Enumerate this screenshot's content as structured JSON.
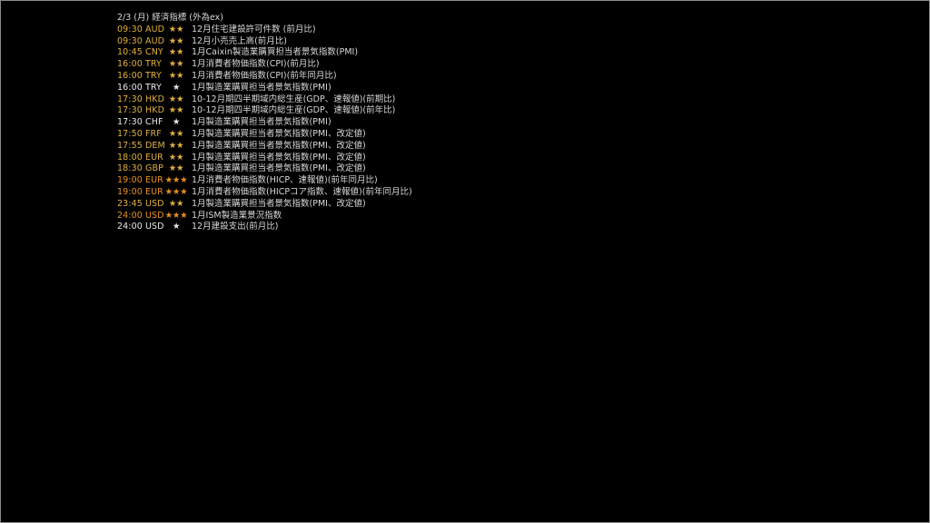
{
  "header": {
    "title": "2/3 (月) 経済指標 (外為ex)"
  },
  "colors": {
    "background": "#000000",
    "border": "#8a8a8a",
    "text_normal": "#d8d8d8",
    "importance_1": "#e8e8e8",
    "importance_2": "#e0b040",
    "importance_3": "#e89020"
  },
  "events": [
    {
      "time_currency": "09:30 AUD",
      "stars": "★★",
      "importance": 2,
      "event": "12月住宅建設許可件数 (前月比)"
    },
    {
      "time_currency": "09:30 AUD",
      "stars": "★★",
      "importance": 2,
      "event": "12月小売売上高(前月比)"
    },
    {
      "time_currency": "10:45 CNY",
      "stars": "★★",
      "importance": 2,
      "event": "1月Caixin製造業購買担当者景気指数(PMI)"
    },
    {
      "time_currency": "16:00 TRY",
      "stars": "★★",
      "importance": 2,
      "event": "1月消費者物価指数(CPI)(前月比)"
    },
    {
      "time_currency": "16:00 TRY",
      "stars": "★★",
      "importance": 2,
      "event": "1月消費者物価指数(CPI)(前年同月比)"
    },
    {
      "time_currency": "16:00 TRY",
      "stars": "★",
      "importance": 1,
      "event": "1月製造業購買担当者景気指数(PMI)"
    },
    {
      "time_currency": "17:30 HKD",
      "stars": "★★",
      "importance": 2,
      "event": "10-12月期四半期域内総生産(GDP、速報値)(前期比)"
    },
    {
      "time_currency": "17:30 HKD",
      "stars": "★★",
      "importance": 2,
      "event": "10-12月期四半期域内総生産(GDP、速報値)(前年比)"
    },
    {
      "time_currency": "17:30 CHF",
      "stars": "★",
      "importance": 1,
      "event": "1月製造業購買担当者景気指数(PMI)"
    },
    {
      "time_currency": "17:50 FRF",
      "stars": "★★",
      "importance": 2,
      "event": "1月製造業購買担当者景気指数(PMI、改定値)"
    },
    {
      "time_currency": "17:55 DEM",
      "stars": "★★",
      "importance": 2,
      "event": "1月製造業購買担当者景気指数(PMI、改定値)"
    },
    {
      "time_currency": "18:00 EUR",
      "stars": "★★",
      "importance": 2,
      "event": "1月製造業購買担当者景気指数(PMI、改定値)"
    },
    {
      "time_currency": "18:30 GBP",
      "stars": "★★",
      "importance": 2,
      "event": "1月製造業購買担当者景気指数(PMI、改定値)"
    },
    {
      "time_currency": "19:00 EUR",
      "stars": "★★★",
      "importance": 3,
      "event": "1月消費者物価指数(HICP、速報値)(前年同月比)"
    },
    {
      "time_currency": "19:00 EUR",
      "stars": "★★★",
      "importance": 3,
      "event": "1月消費者物価指数(HICPコア指数、速報値)(前年同月比)"
    },
    {
      "time_currency": "23:45 USD",
      "stars": "★★",
      "importance": 2,
      "event": "1月製造業購買担当者景気指数(PMI、改定値)"
    },
    {
      "time_currency": "24:00 USD",
      "stars": "★★★",
      "importance": 3,
      "event": "1月ISM製造業景況指数"
    },
    {
      "time_currency": "24:00 USD",
      "stars": "★",
      "importance": 1,
      "event": "12月建設支出(前月比)"
    }
  ]
}
